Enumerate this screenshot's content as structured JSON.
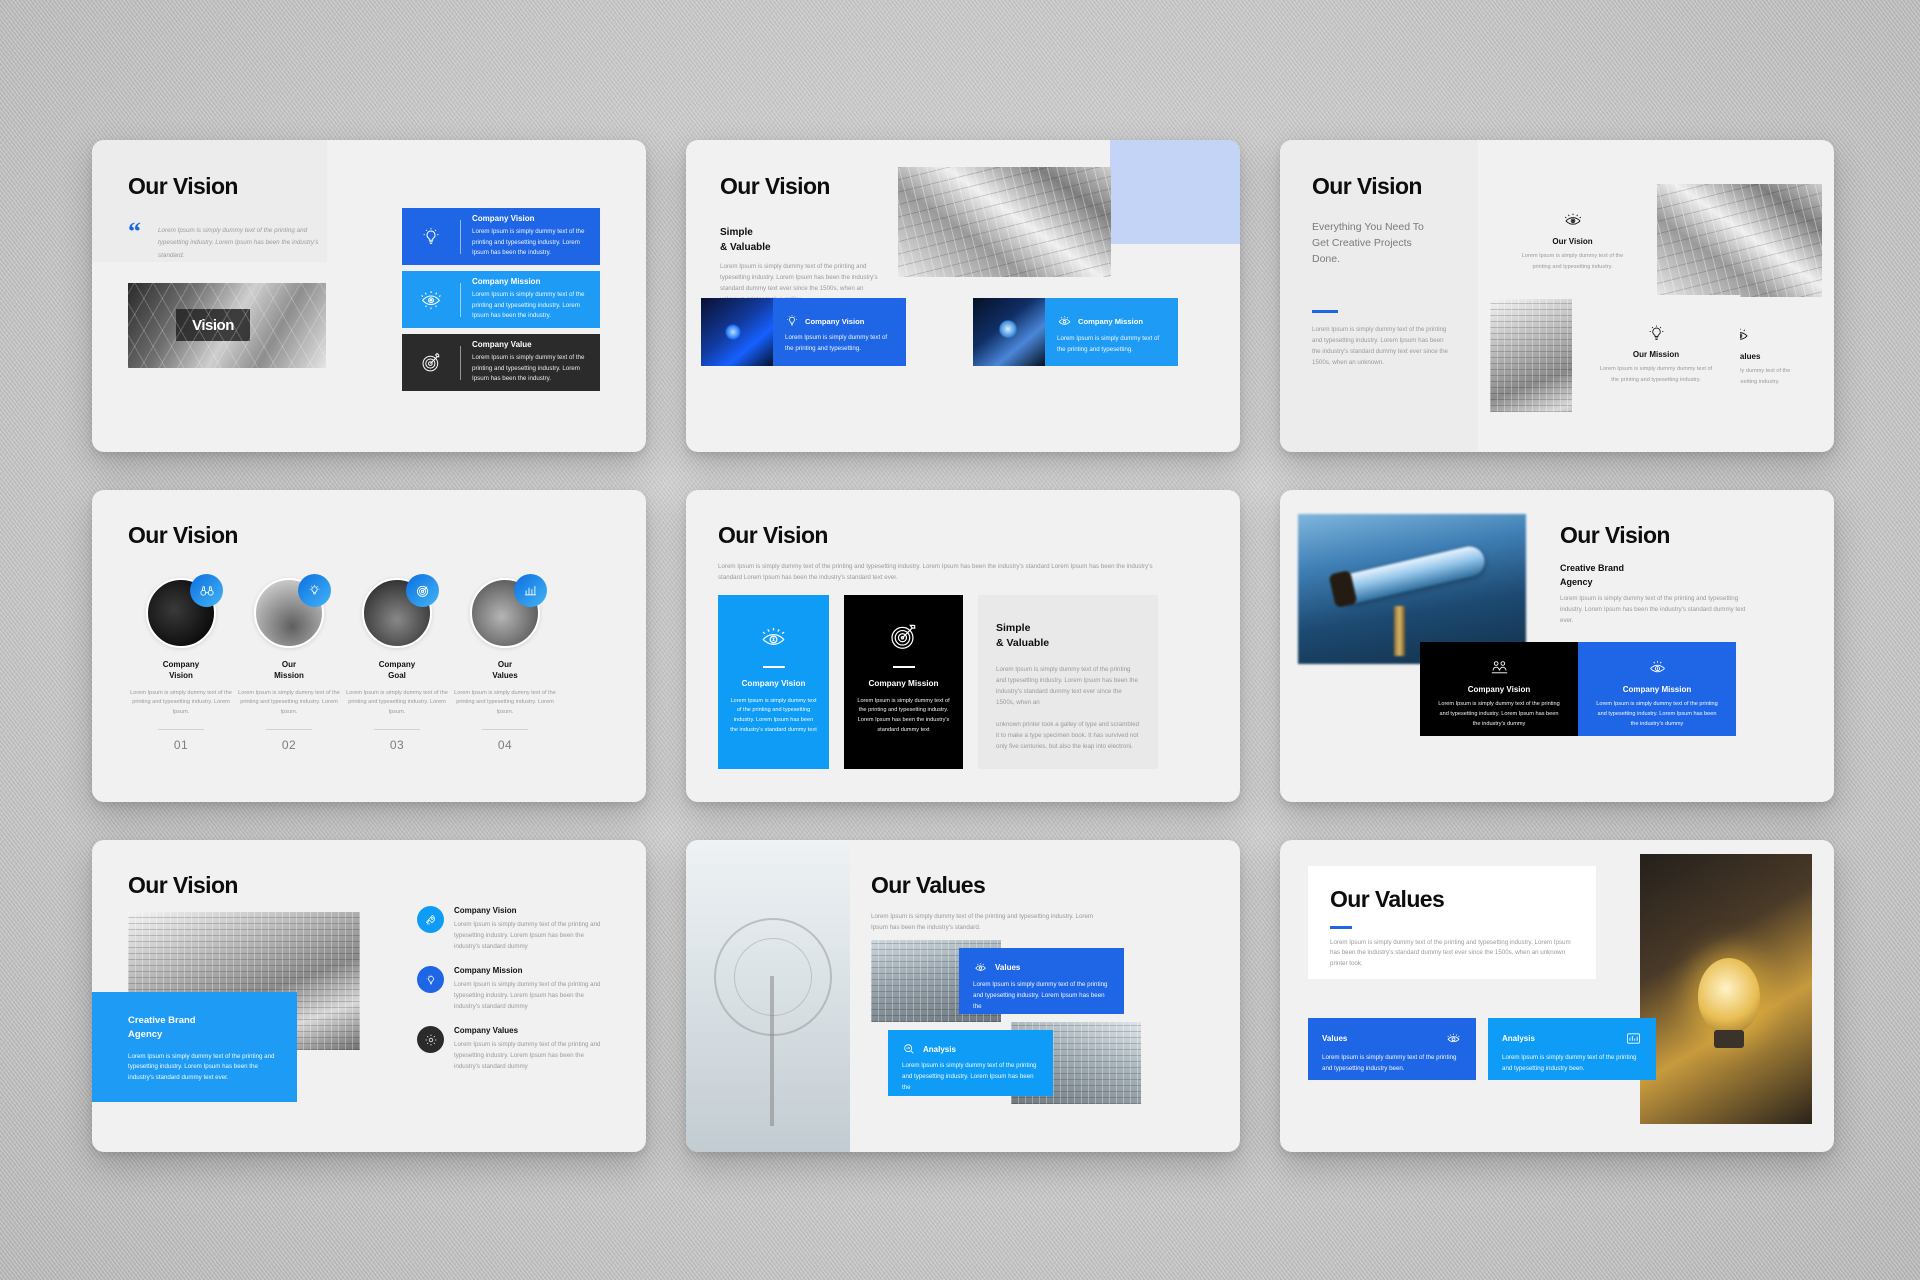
{
  "colors": {
    "blue_dark": "#1f66e6",
    "blue_mid": "#1e9bf5",
    "blue_light": "#0f9cf7",
    "black": "#000000",
    "charcoal": "#2b2b2b",
    "slide_bg": "#f1f1f1",
    "muted_text": "#9a9a9a",
    "pale_blue": "#c3d4f7"
  },
  "lorem": {
    "short": "Lorem Ipsum is simply dummy text of the printing and typesetting industry. Lorem Ipsum has been the industry.",
    "quote": "Lorem Ipsum is simply dummy text of the printing and typesetting industry. Lorem Ipsum has been the industry's standard.",
    "para_a": "Lorem Ipsum is simply dummy text of the printing and typesetting industry. Lorem Ipsum has been the industry's standard dummy text ever since the 1500s, when an unknown printer took a galley.",
    "tile_a": "Lorem Ipsum is simply dummy text of the printing and typesetting.",
    "card_a": "Lorem Ipsum is simply dummy text of the printing and typesetting industry. Lorem Ipsum has been the industry's standard dummy text",
    "card_b": "Lorem Ipsum is simply dummy text of the printing and typesetting industry. Lorem Ipsum.",
    "card_c": "Lorem Ipsum is simply dummy text of the printing and typesetting industry. Lorem Ipsum has been the industry's standard dummy",
    "card_d": "Lorem Ipsum is simply dummy text of the printing and typesetting industry. Lorem Ipsum has been the industry's standard dummy text ever.",
    "card_e": "Lorem Ipsum is simply dummy text of the printing and typesetting industry been.",
    "card_f": "Lorem Ipsum is simply dummy text of the printing and typesetting industry. Lorem Ipsum has been the",
    "card_g": "Lorem Ipsum is simply dummy text of the printing and typesetting industry. Lorem Ipsum has been the",
    "tile_b": "Lorem Ipsum is simply dummy text of the printing and typesetting industry.",
    "tile_c": "Lorem Ipsum is simply dummy text of the printing and typesetting industry.",
    "tile_d": "Lorem Ipsum is simply dummy dummy text of the printing and typesetting industry.",
    "s3_para": "Lorem Ipsum is simply dummy text of the printing and typesetting industry. Lorem Ipsum has been the industry's standard dummy text ever since the 1500s, when an unknown.",
    "s5_para": "Lorem Ipsum is simply dummy text of the printing and typesetting industry. Lorem Ipsum has been the industry's standard Lorem Ipsum has been the industry's standard Lorem Ipsum has been the industry's standard text ever.",
    "s5_p1": "Lorem Ipsum is simply dummy text of the printing and typesetting industry. Lorem Ipsum has been the industry's standard dummy text",
    "s5_right_a": "Lorem Ipsum is simply dummy text of the printing and typesetting industry. Lorem Ipsum has been the industry's standard dummy text ever since the 1500s, when an",
    "s5_right_b": "unknown printer took a galley of type and scrambled it to make a type specimen book. It has survived not only five centuries, but also the leap into electroni.",
    "s6_para": "Lorem Ipsum is simply dummy text of the printing and typesetting industry. Lorem Ipsum has been the industry's standard dummy text ever.",
    "s6_card": "Lorem Ipsum is simply dummy text of the printing and typesetting industry. Lorem Ipsum has been the industry's dummy",
    "s8_para": "Lorem Ipsum is simply dummy text of the printing and typesetting industry. Lorem Ipsum has been the industry's standard.",
    "s9_para": "Lorem Ipsum is simply dummy text of the printing and typesetting industry. Lorem Ipsum has been the industry's standard dummy text ever since the 1500s, when an unknown printer took."
  },
  "slides": [
    {
      "id": "slide-1",
      "title": "Our Vision",
      "cards": [
        {
          "title": "Company Vision",
          "icon": "bulb-icon",
          "theme": "blue-dark"
        },
        {
          "title": "Company Mission",
          "icon": "eye-icon",
          "theme": "blue-mid"
        },
        {
          "title": "Company Value",
          "icon": "target-icon",
          "theme": "charcoal"
        }
      ]
    },
    {
      "id": "slide-2",
      "title": "Our Vision",
      "subtitle_line1": "Simple",
      "subtitle_line2": "& Valuable",
      "cards": [
        {
          "title": "Company Vision",
          "icon": "bulb-icon",
          "theme": "blue-dark"
        },
        {
          "title": "Company Mission",
          "icon": "eye-icon",
          "theme": "blue-mid"
        }
      ]
    },
    {
      "id": "slide-3",
      "title": "Our Vision",
      "headline": "Everything You Need To Get Creative Projects Done.",
      "tiles": [
        {
          "title": "Our Vision",
          "icon": "eye-icon"
        },
        {
          "title": "Our Values",
          "icon": "eye-icon"
        },
        {
          "title": "Our Mission",
          "icon": "bulb-icon"
        }
      ]
    },
    {
      "id": "slide-4",
      "title": "Our Vision",
      "items": [
        {
          "label_line1": "Company",
          "label_line2": "Vision",
          "number": "01",
          "icon": "binocular-icon"
        },
        {
          "label_line1": "Our",
          "label_line2": "Mission",
          "number": "02",
          "icon": "bulb-icon"
        },
        {
          "label_line1": "Company",
          "label_line2": "Goal",
          "number": "03",
          "icon": "target-icon"
        },
        {
          "label_line1": "Our",
          "label_line2": "Values",
          "number": "04",
          "icon": "chart-icon"
        }
      ]
    },
    {
      "id": "slide-5",
      "title": "Our Vision",
      "panels": [
        {
          "title": "Company Vision",
          "icon": "eye-money-icon",
          "theme": "blue-light"
        },
        {
          "title": "Company Mission",
          "icon": "target-icon",
          "theme": "black"
        }
      ],
      "right_heading_line1": "Simple",
      "right_heading_line2": "& Valuable"
    },
    {
      "id": "slide-6",
      "title": "Our Vision",
      "subtitle_line1": "Creative Brand",
      "subtitle_line2": "Agency",
      "cards": [
        {
          "title": "Company Vision",
          "icon": "people-icon",
          "theme": "black"
        },
        {
          "title": "Company Mission",
          "icon": "eye-money-icon",
          "theme": "blue-dark"
        }
      ]
    },
    {
      "id": "slide-7",
      "title": "Our Vision",
      "badge_line1": "Creative Brand",
      "badge_line2": "Agency",
      "items": [
        {
          "title": "Company Vision",
          "icon": "rocket-icon",
          "theme": "blue-light"
        },
        {
          "title": "Company Mission",
          "icon": "bulb-icon",
          "theme": "blue-dark"
        },
        {
          "title": "Company Values",
          "icon": "gear-icon",
          "theme": "charcoal"
        }
      ]
    },
    {
      "id": "slide-8",
      "title": "Our Values",
      "cards": [
        {
          "title": "Values",
          "icon": "eye-icon",
          "theme": "blue-dark"
        },
        {
          "title": "Analysis",
          "icon": "search-icon",
          "theme": "blue-light"
        }
      ]
    },
    {
      "id": "slide-9",
      "title": "Our Values",
      "cards": [
        {
          "title": "Values",
          "icon": "eye-icon",
          "theme": "blue-dark"
        },
        {
          "title": "Analysis",
          "icon": "analytics-icon",
          "theme": "blue-light"
        }
      ]
    }
  ]
}
